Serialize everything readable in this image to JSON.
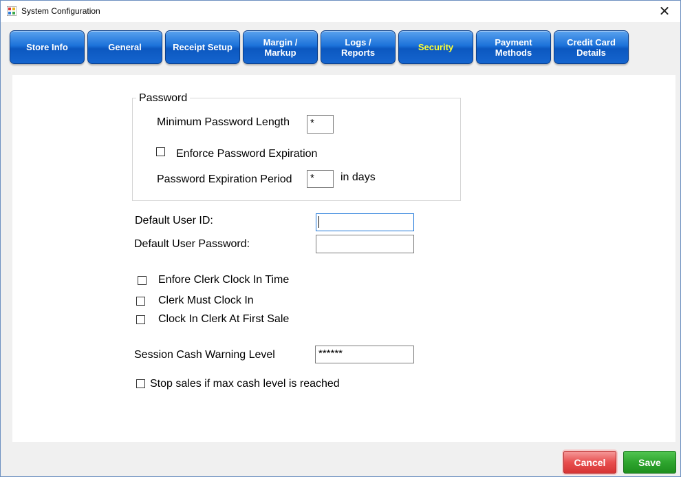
{
  "window": {
    "title": "System Configuration",
    "close_label": "✕"
  },
  "tabs": [
    {
      "label": "Store Info"
    },
    {
      "label": "General"
    },
    {
      "label": "Receipt Setup"
    },
    {
      "label": "Margin /\nMarkup"
    },
    {
      "label": "Logs /\nReports"
    },
    {
      "label": "Security",
      "active": true
    },
    {
      "label": "Payment\nMethods"
    },
    {
      "label": "Credit Card\nDetails"
    }
  ],
  "password_group": {
    "title": "Password",
    "min_length_label": "Minimum Password Length",
    "min_length_value": "*",
    "enforce_expiration_label": "Enforce Password Expiration",
    "enforce_expiration_checked": false,
    "expiration_period_label": "Password Expiration Period",
    "expiration_period_value": "*",
    "expiration_unit": "in days"
  },
  "default_user": {
    "id_label": "Default User ID:",
    "id_value": "",
    "password_label": "Default User Password:",
    "password_value": ""
  },
  "clock": {
    "enforce_clock_in_label": "Enfore Clerk Clock In Time",
    "must_clock_in_label": "Clerk Must Clock In",
    "clock_in_first_sale_label": "Clock In Clerk At First Sale"
  },
  "cash": {
    "warning_label": "Session Cash Warning Level",
    "warning_value": "******",
    "stop_sales_label": "Stop sales if max cash level  is reached"
  },
  "footer": {
    "cancel_label": "Cancel",
    "save_label": "Save"
  },
  "colors": {
    "tab_blue": "#1565cf",
    "active_tab_text": "#ffff33",
    "cancel_red": "#e84f4f",
    "save_green": "#2ea52e"
  }
}
